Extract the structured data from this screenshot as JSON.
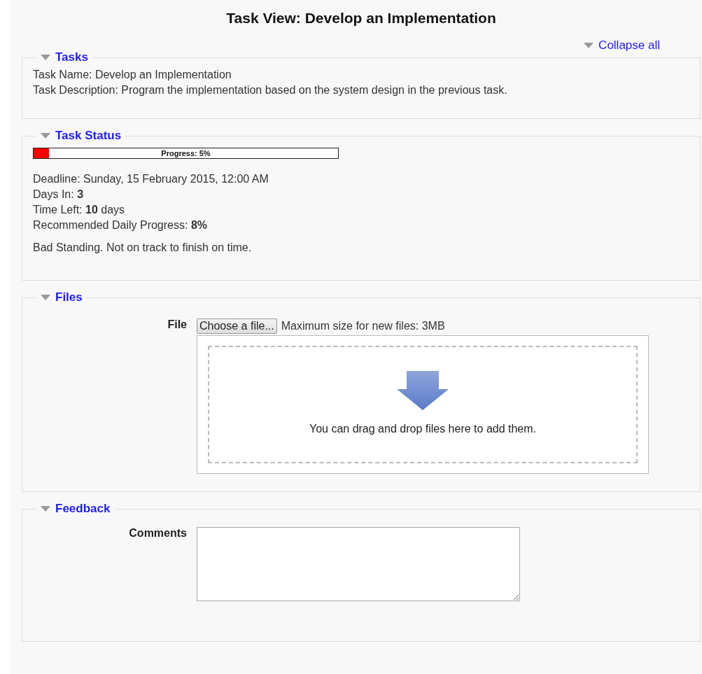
{
  "title": "Task View: Develop an Implementation",
  "collapse_all": "Collapse all",
  "sections": [
    {
      "kind": "lines",
      "legend": "Tasks",
      "expanded": true,
      "lines": [
        "Task Name: Develop an Implementation",
        "Task Description: Program the implementation based on the system design in the previous task."
      ]
    },
    {
      "kind": "status",
      "legend": "Task Status",
      "expanded": true,
      "progress": {
        "label": "Progress: 5%",
        "level": 0.05
      },
      "lines": [
        "Deadline: Sunday, 15 February 2015, 12:00 AM",
        "Days In: **3**",
        "Time Left: **10** days",
        "Recommended Daily Progress: **8%**"
      ],
      "standing": "Bad Standing. Not on track to finish on time."
    },
    {
      "kind": "files",
      "legend": "Files",
      "expanded": true,
      "label": "File",
      "button": "Choose a file...",
      "note": "Maximum size for new files: 3MB",
      "drop_text": "You can drag and drop files here to add them."
    },
    {
      "kind": "comments",
      "legend": "Feedback",
      "expanded": true,
      "label": "Comments"
    }
  ]
}
